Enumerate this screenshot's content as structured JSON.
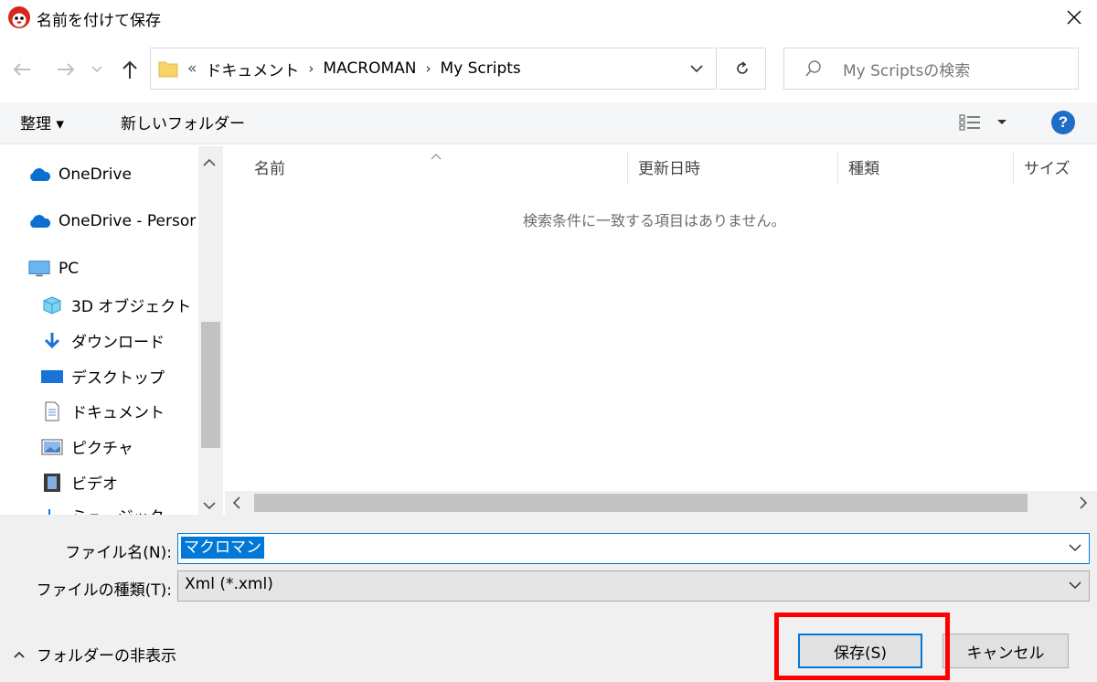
{
  "window": {
    "title": "名前を付けて保存"
  },
  "address": {
    "overflow": "«",
    "crumbs": [
      "ドキュメント",
      "MACROMAN",
      "My Scripts"
    ],
    "search_placeholder": "My Scriptsの検索"
  },
  "toolbar": {
    "organize": "整理 ▾",
    "new_folder": "新しいフォルダー",
    "help": "?"
  },
  "nav": {
    "items": [
      {
        "label": "OneDrive",
        "icon": "cloud-icon"
      },
      {
        "label": "OneDrive - Persor",
        "icon": "cloud-icon"
      },
      {
        "label": "PC",
        "icon": "computer-icon"
      },
      {
        "label": "3D オブジェクト",
        "icon": "cube-icon"
      },
      {
        "label": "ダウンロード",
        "icon": "download-arrow-icon"
      },
      {
        "label": "デスクトップ",
        "icon": "desktop-icon"
      },
      {
        "label": "ドキュメント",
        "icon": "document-icon"
      },
      {
        "label": "ピクチャ",
        "icon": "picture-icon"
      },
      {
        "label": "ビデオ",
        "icon": "video-icon"
      },
      {
        "label": "ミュージック",
        "icon": "music-icon"
      }
    ]
  },
  "list": {
    "columns": [
      "名前",
      "更新日時",
      "種類",
      "サイズ"
    ],
    "empty_message": "検索条件に一致する項目はありません。"
  },
  "form": {
    "filename_label": "ファイル名(N):",
    "filename_value": "マクロマン",
    "filetype_label": "ファイルの種類(T):",
    "filetype_value": "Xml (*.xml)"
  },
  "footer": {
    "hide_folders": "フォルダーの非表示",
    "save": "保存(S)",
    "cancel": "キャンセル"
  },
  "colors": {
    "accent": "#0078d7",
    "highlight": "#ff0000"
  }
}
